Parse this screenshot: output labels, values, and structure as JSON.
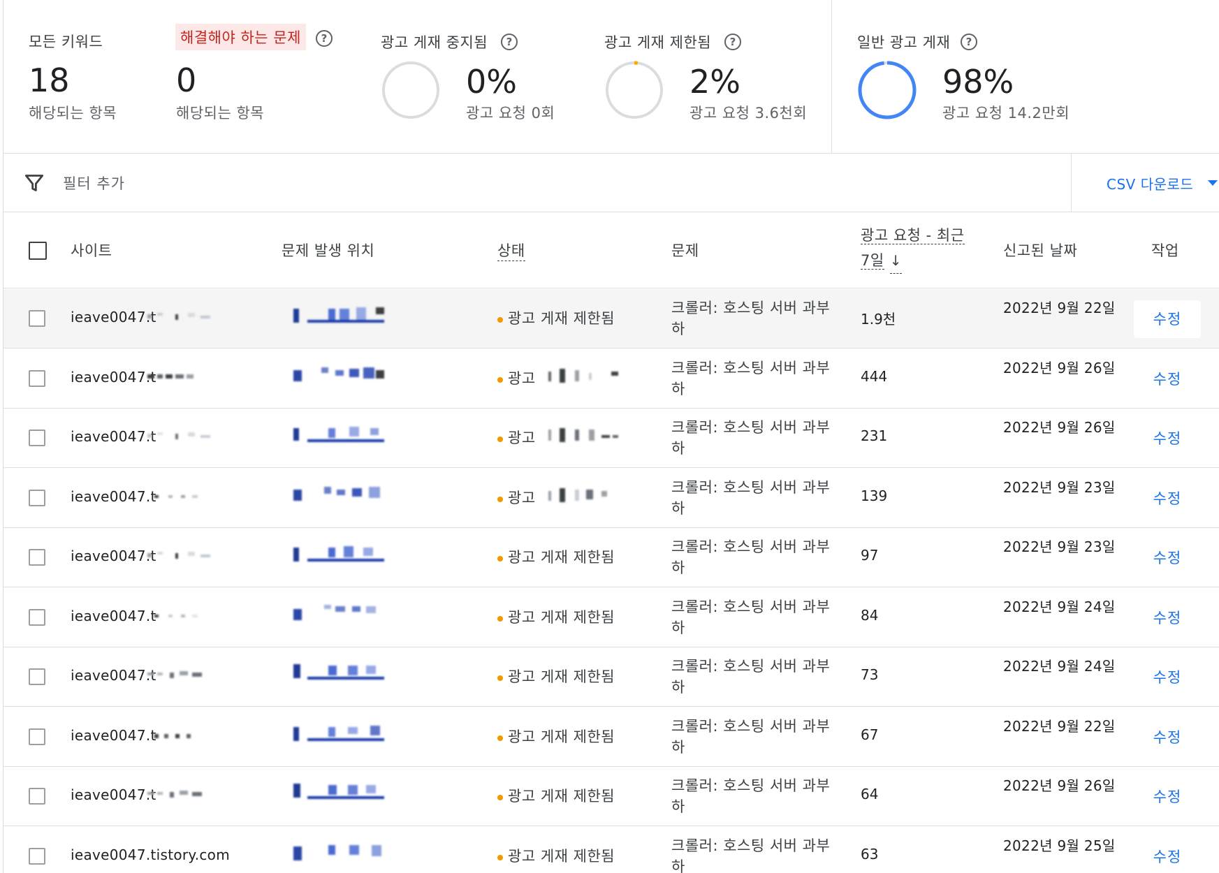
{
  "summary": {
    "all_keywords": {
      "label": "모든 키워드",
      "value": "18",
      "sub": "해당되는 항목"
    },
    "issues": {
      "label": "해결해야 하는 문제",
      "value": "0",
      "sub": "해당되는 항목"
    },
    "stopped": {
      "label": "광고 게재 중지됨",
      "value": "0%",
      "sub": "광고 요청 0회",
      "fraction": 0.0,
      "color": "#dadce0"
    },
    "limited": {
      "label": "광고 게재 제한됨",
      "value": "2%",
      "sub": "광고 요청 3.6천회",
      "fraction": 0.02,
      "color": "#f9ab00"
    },
    "general": {
      "label": "일반 광고 게재",
      "value": "98%",
      "sub": "광고 요청 14.2만회",
      "fraction": 0.98,
      "color": "#4285f4"
    },
    "help_icon": "help-circle-icon"
  },
  "filter": {
    "placeholder": "필터 추가",
    "icon": "filter-icon"
  },
  "csv": {
    "label": "CSV 다운로드",
    "icon": "caret-down-icon"
  },
  "table": {
    "headers": {
      "site": "사이트",
      "location": "문제 발생 위치",
      "status": "상태",
      "issue": "문제",
      "requests": "광고 요청 - 최근 7일",
      "requests_line1": "광고 요청 - 최근",
      "requests_line2": "7일",
      "date": "신고된 날짜",
      "action": "작업"
    },
    "rows": [
      {
        "site": "ieave0047.t",
        "status": "광고 게재 제한됨",
        "issue": "크롤러: 호스팅 서버 과부하",
        "requests": "1.9천",
        "date": "2022년 9월 22일",
        "action": "수정"
      },
      {
        "site": "ieave0047.t",
        "status": "광고",
        "issue": "크롤러: 호스팅 서버 과부하",
        "requests": "444",
        "date": "2022년 9월 26일",
        "action": "수정"
      },
      {
        "site": "ieave0047.t",
        "status": "광고",
        "issue": "크롤러: 호스팅 서버 과부하",
        "requests": "231",
        "date": "2022년 9월 26일",
        "action": "수정"
      },
      {
        "site": "ieave0047.t",
        "status": "광고",
        "issue": "크롤러: 호스팅 서버 과부하",
        "requests": "139",
        "date": "2022년 9월 23일",
        "action": "수정"
      },
      {
        "site": "ieave0047.t",
        "status": "광고 게재 제한됨",
        "issue": "크롤러: 호스팅 서버 과부하",
        "requests": "97",
        "date": "2022년 9월 23일",
        "action": "수정"
      },
      {
        "site": "ieave0047.t",
        "status": "광고 게재 제한됨",
        "issue": "크롤러: 호스팅 서버 과부하",
        "requests": "84",
        "date": "2022년 9월 24일",
        "action": "수정"
      },
      {
        "site": "ieave0047.t",
        "status": "광고 게재 제한됨",
        "issue": "크롤러: 호스팅 서버 과부하",
        "requests": "73",
        "date": "2022년 9월 24일",
        "action": "수정"
      },
      {
        "site": "ieave0047.t",
        "status": "광고 게재 제한됨",
        "issue": "크롤러: 호스팅 서버 과부하",
        "requests": "67",
        "date": "2022년 9월 22일",
        "action": "수정"
      },
      {
        "site": "ieave0047.t",
        "status": "광고 게재 제한됨",
        "issue": "크롤러: 호스팅 서버 과부하",
        "requests": "64",
        "date": "2022년 9월 26일",
        "action": "수정"
      },
      {
        "site": "ieave0047.tistory.com",
        "status": "광고 게재 제한됨",
        "issue": "크롤러: 호스팅 서버 과부하",
        "requests": "63",
        "date": "2022년 9월 25일",
        "action": "수정"
      }
    ]
  },
  "colors": {
    "accent": "#1a73e8",
    "status_dot": "#f29900",
    "warn_bg": "#fce8e6",
    "warn_text": "#c5221f"
  }
}
